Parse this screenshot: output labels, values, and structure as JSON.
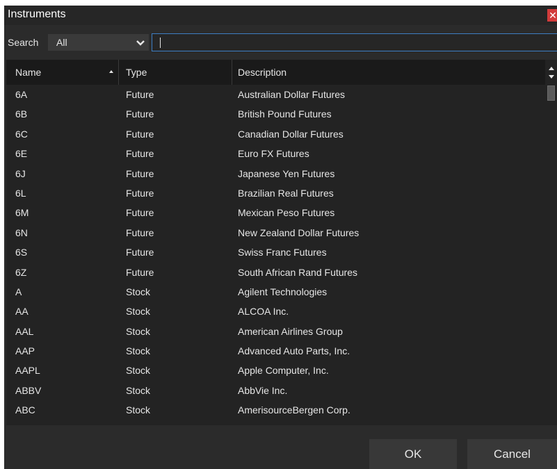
{
  "window": {
    "title": "Instruments",
    "close_icon": "close-icon",
    "accent_color": "#3d7fc4",
    "close_color": "#d23b3b"
  },
  "search": {
    "label": "Search",
    "filter_value": "All",
    "input_value": "",
    "input_placeholder": ""
  },
  "table": {
    "columns": [
      "Name",
      "Type",
      "Description"
    ],
    "sort_column": "Name",
    "sort_direction": "ascending",
    "rows": [
      {
        "name": "6A",
        "type": "Future",
        "description": "Australian Dollar Futures"
      },
      {
        "name": "6B",
        "type": "Future",
        "description": "British Pound Futures"
      },
      {
        "name": "6C",
        "type": "Future",
        "description": "Canadian Dollar Futures"
      },
      {
        "name": "6E",
        "type": "Future",
        "description": "Euro FX Futures"
      },
      {
        "name": "6J",
        "type": "Future",
        "description": "Japanese Yen Futures"
      },
      {
        "name": "6L",
        "type": "Future",
        "description": "Brazilian Real Futures"
      },
      {
        "name": "6M",
        "type": "Future",
        "description": "Mexican Peso Futures"
      },
      {
        "name": "6N",
        "type": "Future",
        "description": "New Zealand Dollar Futures"
      },
      {
        "name": "6S",
        "type": "Future",
        "description": "Swiss Franc Futures"
      },
      {
        "name": "6Z",
        "type": "Future",
        "description": "South African Rand Futures"
      },
      {
        "name": "A",
        "type": "Stock",
        "description": "Agilent Technologies"
      },
      {
        "name": "AA",
        "type": "Stock",
        "description": "ALCOA Inc."
      },
      {
        "name": "AAL",
        "type": "Stock",
        "description": "American Airlines Group"
      },
      {
        "name": "AAP",
        "type": "Stock",
        "description": "Advanced Auto Parts, Inc."
      },
      {
        "name": "AAPL",
        "type": "Stock",
        "description": "Apple Computer, Inc."
      },
      {
        "name": "ABBV",
        "type": "Stock",
        "description": "AbbVie Inc."
      },
      {
        "name": "ABC",
        "type": "Stock",
        "description": "AmerisourceBergen Corp."
      }
    ]
  },
  "buttons": {
    "ok_label": "OK",
    "cancel_label": "Cancel"
  }
}
